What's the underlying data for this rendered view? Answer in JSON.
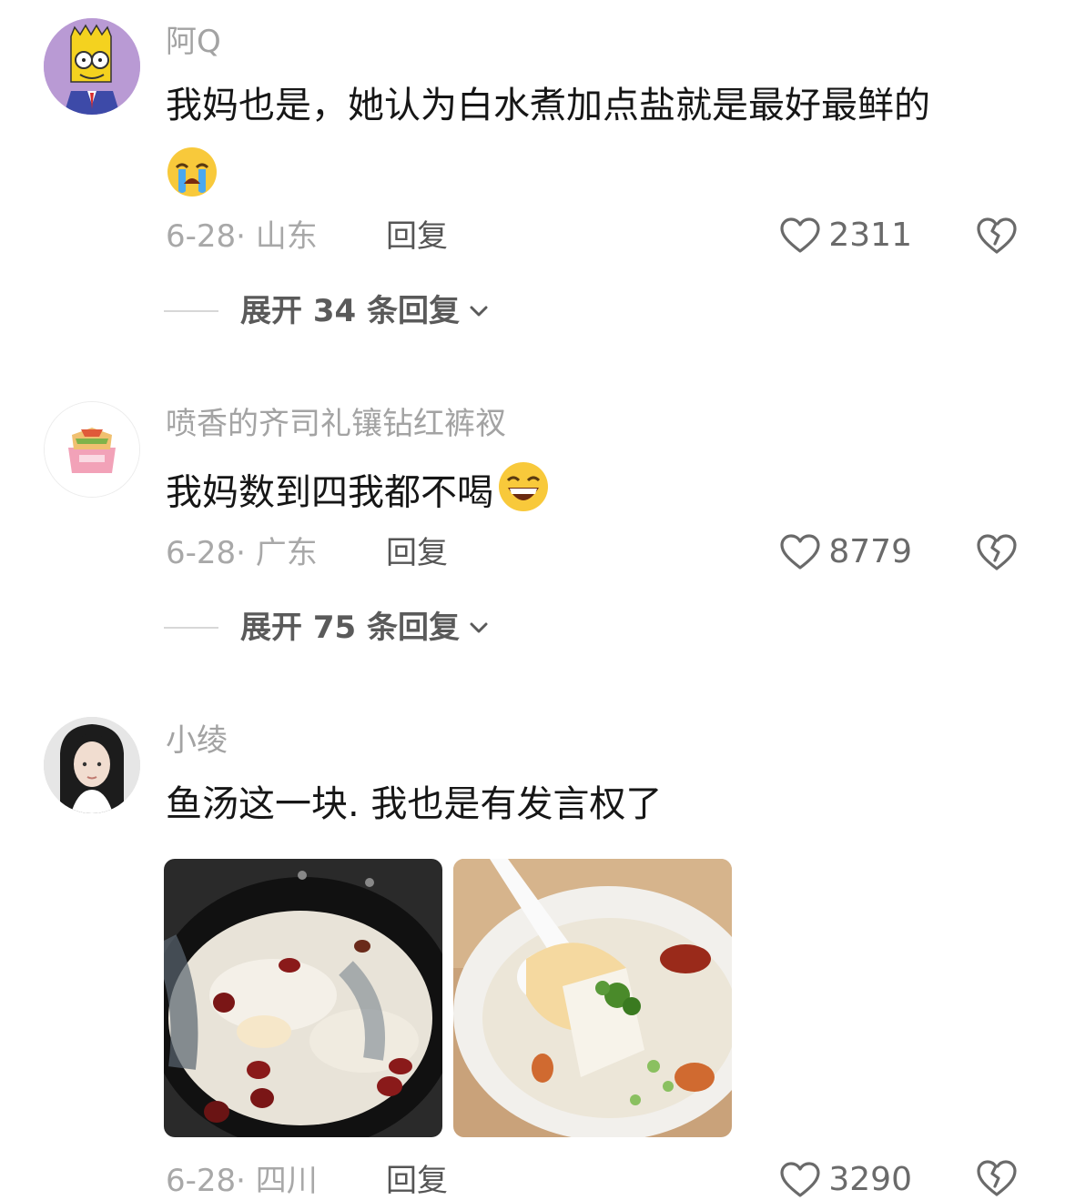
{
  "comments": [
    {
      "username": "阿Q",
      "text": "我妈也是，她认为白水煮加点盐就是最好最鲜的",
      "emoji": "loudly-crying-face",
      "date_location": "6-28· 山东",
      "reply_label": "回复",
      "likes": "2311",
      "expand_label": "展开 34 条回复"
    },
    {
      "username": "喷香的齐司礼镶钻红裤衩",
      "text": "我妈数到四我都不喝",
      "emoji": "grinning-squinting-face",
      "date_location": "6-28· 广东",
      "reply_label": "回复",
      "likes": "8779",
      "expand_label": "展开 75 条回复"
    },
    {
      "username": "小绫",
      "text": "鱼汤这一块. 我也是有发言权了",
      "images": [
        "fish-soup-in-wok-photo",
        "fish-soup-in-bowl-photo"
      ],
      "date_location": "6-28· 四川",
      "reply_label": "回复",
      "likes": "3290"
    }
  ],
  "colors": {
    "text": "#161616",
    "muted": "#a3a3a3",
    "action": "#555555"
  }
}
